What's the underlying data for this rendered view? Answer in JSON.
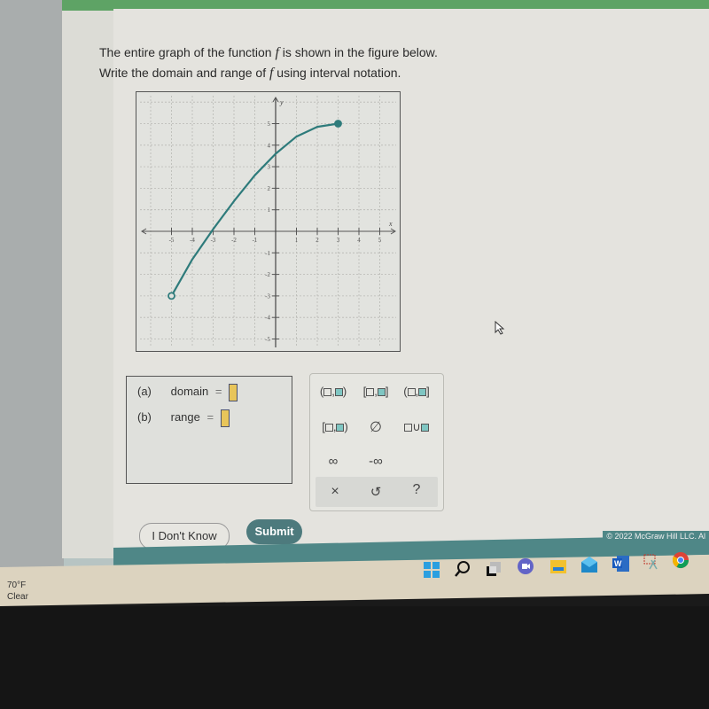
{
  "question": {
    "line1_prefix": "The entire graph of the function ",
    "line1_var": "f",
    "line1_suffix": " is shown in the figure below.",
    "line2_prefix": "Write the domain and range of ",
    "line2_var": "f",
    "line2_suffix": " using interval notation."
  },
  "chart_data": {
    "type": "line",
    "title": "",
    "xlabel": "x",
    "ylabel": "y",
    "xlim": [
      -6,
      6
    ],
    "ylim": [
      -6,
      6
    ],
    "x_ticks": [
      -5,
      -4,
      -3,
      -2,
      -1,
      1,
      2,
      3,
      4,
      5
    ],
    "y_ticks": [
      -5,
      -4,
      -3,
      -2,
      -1,
      1,
      2,
      3,
      4,
      5
    ],
    "grid": true,
    "series": [
      {
        "name": "f",
        "color": "#2e7b7b",
        "points": [
          [
            -5,
            -3
          ],
          [
            -4,
            -1.3
          ],
          [
            -3,
            0.1
          ],
          [
            -2,
            1.4
          ],
          [
            -1,
            2.6
          ],
          [
            0,
            3.6
          ],
          [
            1,
            4.4
          ],
          [
            2,
            4.85
          ],
          [
            3,
            5
          ]
        ]
      }
    ],
    "endpoints": [
      {
        "x": -5,
        "y": -3,
        "type": "open"
      },
      {
        "x": 3,
        "y": 5,
        "type": "closed"
      }
    ]
  },
  "answer": {
    "a_label": "(a)",
    "domain_label": "domain",
    "b_label": "(b)",
    "range_label": "range",
    "equals": "=",
    "domain_value": "",
    "range_value": ""
  },
  "keypad": {
    "open_open": [
      "(",
      ",",
      ")"
    ],
    "closed_closed": [
      "[",
      ",",
      "]"
    ],
    "open_closed": [
      "(",
      ",",
      "]"
    ],
    "closed_open": [
      "[",
      ",",
      ")"
    ],
    "empty_set": "∅",
    "union": "∪",
    "infinity": "∞",
    "neg_infinity": "-∞",
    "clear": "×",
    "undo": "↺",
    "help": "?"
  },
  "buttons": {
    "dont_know": "I Don't Know",
    "submit": "Submit"
  },
  "footer": {
    "copyright": "© 2022 McGraw Hill LLC. Al"
  },
  "taskbar": {
    "weather_temp": "70°F",
    "weather_desc": "Clear",
    "icons": [
      "windows-start",
      "search",
      "task-view",
      "teams-chat",
      "file-explorer",
      "mail",
      "word",
      "snipping-tool",
      "chrome"
    ]
  },
  "colors": {
    "curve": "#2e7b7b",
    "submit": "#4d7a7d",
    "footer": "#4f8787",
    "topbar": "#5ea365",
    "slot": "#e8c55a"
  }
}
